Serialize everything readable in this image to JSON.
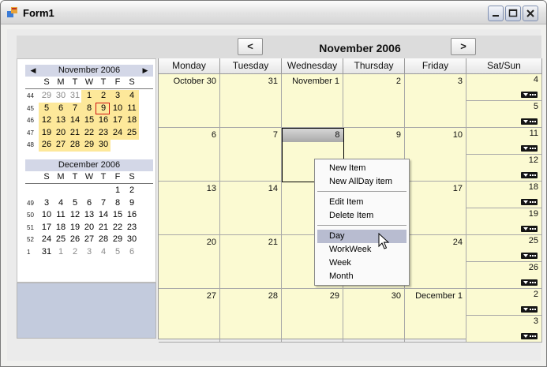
{
  "window": {
    "title": "Form1"
  },
  "nav": {
    "prev": "<",
    "next": ">",
    "month_title": "November 2006"
  },
  "mini_calendar": {
    "dow": [
      "S",
      "M",
      "T",
      "W",
      "T",
      "F",
      "S"
    ],
    "months": [
      {
        "title": "November 2006",
        "weeks": [
          {
            "wk": "44",
            "days": [
              "29",
              "30",
              "31",
              "1",
              "2",
              "3",
              "4"
            ]
          },
          {
            "wk": "45",
            "days": [
              "5",
              "6",
              "7",
              "8",
              "9",
              "10",
              "11"
            ]
          },
          {
            "wk": "46",
            "days": [
              "12",
              "13",
              "14",
              "15",
              "16",
              "17",
              "18"
            ]
          },
          {
            "wk": "47",
            "days": [
              "19",
              "20",
              "21",
              "22",
              "23",
              "24",
              "25"
            ]
          },
          {
            "wk": "48",
            "days": [
              "26",
              "27",
              "28",
              "29",
              "30"
            ]
          }
        ]
      },
      {
        "title": "December 2006",
        "weeks": [
          {
            "wk": "",
            "days": [
              "",
              "",
              "",
              "",
              "",
              "1",
              "2"
            ]
          },
          {
            "wk": "49",
            "days": [
              "3",
              "4",
              "5",
              "6",
              "7",
              "8",
              "9"
            ]
          },
          {
            "wk": "50",
            "days": [
              "10",
              "11",
              "12",
              "13",
              "14",
              "15",
              "16"
            ]
          },
          {
            "wk": "51",
            "days": [
              "17",
              "18",
              "19",
              "20",
              "21",
              "22",
              "23"
            ]
          },
          {
            "wk": "52",
            "days": [
              "24",
              "25",
              "26",
              "27",
              "28",
              "29",
              "30"
            ]
          },
          {
            "wk": "1",
            "days": [
              "31",
              "1",
              "2",
              "3",
              "4",
              "5",
              "6"
            ]
          }
        ]
      }
    ],
    "selected_day": "9",
    "prev_arrow": "◀",
    "next_arrow": "▶"
  },
  "headers": [
    "Monday",
    "Tuesday",
    "Wednesday",
    "Thursday",
    "Friday",
    "Sat/Sun"
  ],
  "weeks": [
    {
      "days": [
        "October 30",
        "31",
        "November 1",
        "2",
        "3"
      ],
      "sat": "4",
      "sun": "5"
    },
    {
      "days": [
        "6",
        "7",
        "8",
        "9",
        "10"
      ],
      "sat": "11",
      "sun": "12"
    },
    {
      "days": [
        "13",
        "14",
        "",
        "",
        "17"
      ],
      "sat": "18",
      "sun": "19"
    },
    {
      "days": [
        "20",
        "21",
        "",
        "",
        "24"
      ],
      "sat": "25",
      "sun": "26"
    },
    {
      "days": [
        "27",
        "28",
        "29",
        "30",
        "December 1"
      ],
      "sat": "2",
      "sun": "3"
    }
  ],
  "context_menu": {
    "new_item": "New Item",
    "new_allday": "New AllDay item",
    "edit_item": "Edit Item",
    "delete_item": "Delete Item",
    "day": "Day",
    "workweek": "WorkWeek",
    "week": "Week",
    "month": "Month"
  },
  "colors": {
    "day_bg": "#fbfad2",
    "mini_highlight": "#fde89a",
    "menu_active": "#b8bcd0"
  }
}
